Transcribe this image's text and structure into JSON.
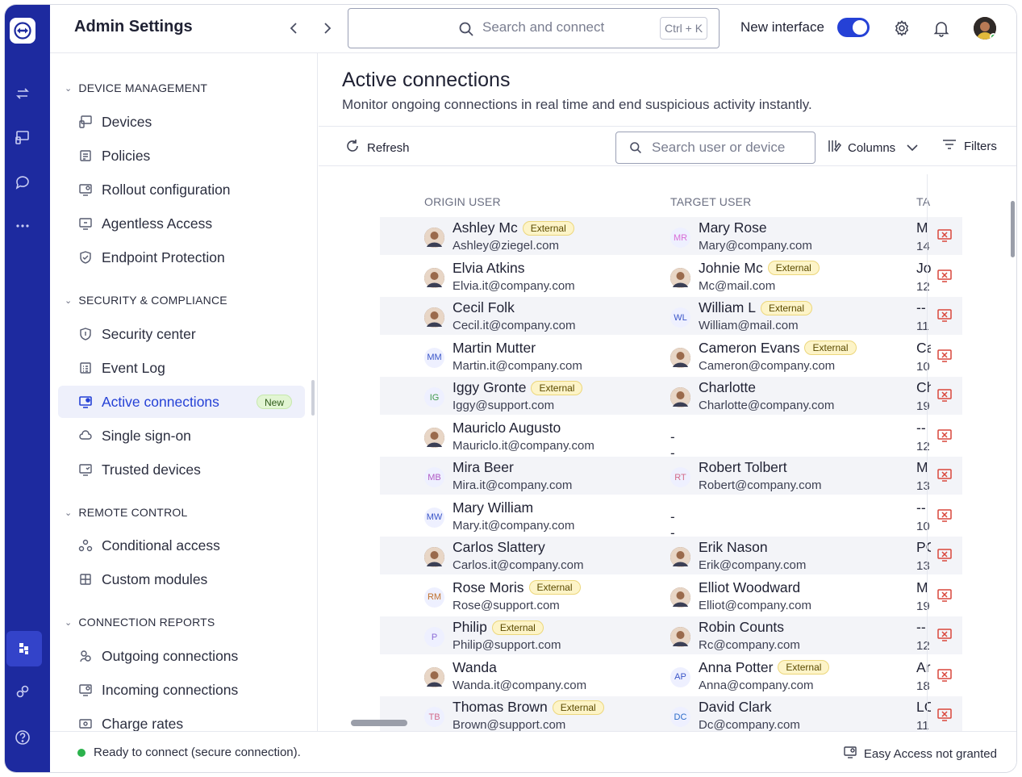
{
  "header": {
    "title": "Admin Settings",
    "search_placeholder": "Search and connect",
    "shortcut": "Ctrl + K",
    "new_interface_label": "New interface",
    "new_interface_on": true
  },
  "sidebar": {
    "sections": [
      {
        "title": "DEVICE MANAGEMENT",
        "items": [
          "Devices",
          "Policies",
          "Rollout configuration",
          "Agentless Access",
          "Endpoint Protection"
        ]
      },
      {
        "title": "SECURITY & COMPLIANCE",
        "items": [
          "Security center",
          "Event Log",
          "Active connections",
          "Single sign-on",
          "Trusted devices"
        ]
      },
      {
        "title": "REMOTE CONTROL",
        "items": [
          "Conditional access",
          "Custom modules"
        ]
      },
      {
        "title": "CONNECTION REPORTS",
        "items": [
          "Outgoing connections",
          "Incoming connections",
          "Charge rates"
        ]
      }
    ],
    "active_item": "Active connections",
    "new_badge": "New"
  },
  "page": {
    "title": "Active connections",
    "subtitle": "Monitor ongoing connections in real time and end suspicious activity instantly."
  },
  "toolbar": {
    "refresh_label": "Refresh",
    "search_placeholder": "Search user or device",
    "columns_label": "Columns",
    "filters_label": "Filters"
  },
  "table": {
    "headers": [
      "ORIGIN USER",
      "TARGET USER",
      "TA"
    ],
    "external_label": "External",
    "rows": [
      {
        "origin": {
          "name": "Ashley Mc",
          "email": "Ashley@ziegel.com",
          "external": true,
          "avatar": "photo",
          "initials": ""
        },
        "target": {
          "name": "Mary Rose",
          "email": "Mary@company.com",
          "external": false,
          "avatar": "initials",
          "initials": "MR",
          "color": "#d86bd6"
        },
        "ta": [
          "M",
          "14"
        ]
      },
      {
        "origin": {
          "name": "Elvia Atkins",
          "email": "Elvia.it@company.com",
          "external": false,
          "avatar": "photo",
          "initials": ""
        },
        "target": {
          "name": "Johnie Mc",
          "email": "Mc@mail.com",
          "external": true,
          "avatar": "photo",
          "initials": ""
        },
        "ta": [
          "Jo",
          "12"
        ]
      },
      {
        "origin": {
          "name": "Cecil Folk",
          "email": "Cecil.it@company.com",
          "external": false,
          "avatar": "photo",
          "initials": ""
        },
        "target": {
          "name": "William L",
          "email": "William@mail.com",
          "external": true,
          "avatar": "initials",
          "initials": "WL",
          "color": "#3a55c8"
        },
        "ta": [
          "--",
          "11"
        ]
      },
      {
        "origin": {
          "name": "Martin Mutter",
          "email": "Martin.it@company.com",
          "external": false,
          "avatar": "initials",
          "initials": "MM",
          "color": "#3a55c8"
        },
        "target": {
          "name": "Cameron Evans",
          "email": "Cameron@company.com",
          "external": true,
          "avatar": "photo",
          "initials": ""
        },
        "ta": [
          "Ca",
          "10"
        ]
      },
      {
        "origin": {
          "name": "Iggy Gronte",
          "email": "Iggy@support.com",
          "external": true,
          "avatar": "initials",
          "initials": "IG",
          "color": "#3f9a4a"
        },
        "target": {
          "name": "Charlotte",
          "email": "Charlotte@company.com",
          "external": false,
          "avatar": "photo",
          "initials": ""
        },
        "ta": [
          "Ch",
          "19"
        ]
      },
      {
        "origin": {
          "name": "Mauriclo Augusto",
          "email": "Mauriclo.it@company.com",
          "external": false,
          "avatar": "photo",
          "initials": ""
        },
        "target": null,
        "ta": [
          "--",
          "12"
        ]
      },
      {
        "origin": {
          "name": "Mira Beer",
          "email": "Mira.it@company.com",
          "external": false,
          "avatar": "initials",
          "initials": "MB",
          "color": "#b05ac4"
        },
        "target": {
          "name": "Robert Tolbert",
          "email": "Robert@company.com",
          "external": false,
          "avatar": "initials",
          "initials": "RT",
          "color": "#d36b8a"
        },
        "ta": [
          "M",
          "13"
        ]
      },
      {
        "origin": {
          "name": "Mary William",
          "email": "Mary.it@company.com",
          "external": false,
          "avatar": "initials",
          "initials": "MW",
          "color": "#3a55c8"
        },
        "target": null,
        "ta": [
          "--",
          "10"
        ]
      },
      {
        "origin": {
          "name": "Carlos Slattery",
          "email": "Carlos.it@company.com",
          "external": false,
          "avatar": "photo",
          "initials": ""
        },
        "target": {
          "name": "Erik Nason",
          "email": "Erik@company.com",
          "external": false,
          "avatar": "photo",
          "initials": ""
        },
        "ta": [
          "PC",
          "13"
        ]
      },
      {
        "origin": {
          "name": "Rose Moris",
          "email": "Rose@support.com",
          "external": true,
          "avatar": "initials",
          "initials": "RM",
          "color": "#c0702a"
        },
        "target": {
          "name": "Elliot Woodward",
          "email": "Elliot@company.com",
          "external": false,
          "avatar": "photo",
          "initials": ""
        },
        "ta": [
          "M",
          "19"
        ]
      },
      {
        "origin": {
          "name": "Philip",
          "email": "Philip@support.com",
          "external": true,
          "avatar": "initials",
          "initials": "P",
          "color": "#8a6ad6"
        },
        "target": {
          "name": "Robin Counts",
          "email": "Rc@company.com",
          "external": false,
          "avatar": "photo",
          "initials": ""
        },
        "ta": [
          "--",
          "12"
        ]
      },
      {
        "origin": {
          "name": "Wanda",
          "email": "Wanda.it@company.com",
          "external": false,
          "avatar": "photo",
          "initials": ""
        },
        "target": {
          "name": "Anna Potter",
          "email": "Anna@company.com",
          "external": true,
          "avatar": "initials",
          "initials": "AP",
          "color": "#3a55c8"
        },
        "ta": [
          "Ar",
          "18"
        ]
      },
      {
        "origin": {
          "name": "Thomas Brown",
          "email": "Brown@support.com",
          "external": true,
          "avatar": "initials",
          "initials": "TB",
          "color": "#d36b8a"
        },
        "target": {
          "name": "David Clark",
          "email": "Dc@company.com",
          "external": false,
          "avatar": "initials",
          "initials": "DC",
          "color": "#2a6ac8"
        },
        "ta": [
          "LC",
          "11"
        ]
      }
    ]
  },
  "status": {
    "text": "Ready to connect (secure connection).",
    "easy_access": "Easy Access not granted"
  },
  "colors": {
    "rail": "#1d2a9f",
    "accent": "#2541d6",
    "end_session": "#d9463b",
    "online": "#2bb24c"
  }
}
